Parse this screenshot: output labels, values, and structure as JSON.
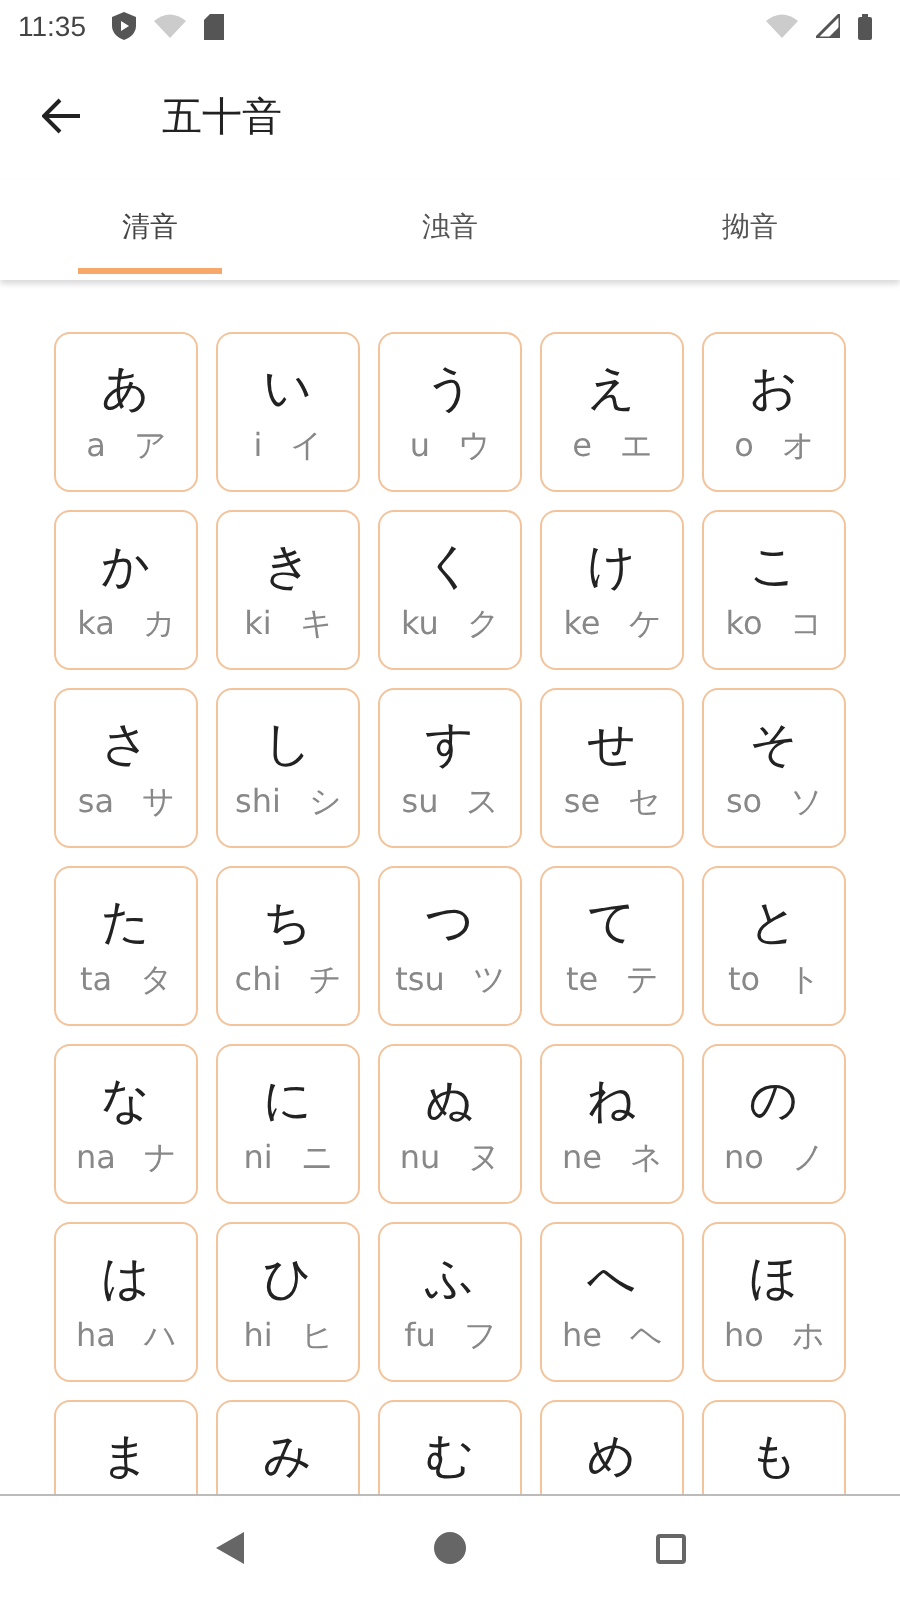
{
  "status_bar": {
    "time": "11:35"
  },
  "app_bar": {
    "title": "五十音"
  },
  "tabs": [
    {
      "label": "清音",
      "selected": true
    },
    {
      "label": "浊音",
      "selected": false
    },
    {
      "label": "拗音",
      "selected": false
    }
  ],
  "cards": [
    {
      "kana": "あ",
      "romaji": "a",
      "katakana": "ア"
    },
    {
      "kana": "い",
      "romaji": "i",
      "katakana": "イ"
    },
    {
      "kana": "う",
      "romaji": "u",
      "katakana": "ウ"
    },
    {
      "kana": "え",
      "romaji": "e",
      "katakana": "エ"
    },
    {
      "kana": "お",
      "romaji": "o",
      "katakana": "オ"
    },
    {
      "kana": "か",
      "romaji": "ka",
      "katakana": "カ"
    },
    {
      "kana": "き",
      "romaji": "ki",
      "katakana": "キ"
    },
    {
      "kana": "く",
      "romaji": "ku",
      "katakana": "ク"
    },
    {
      "kana": "け",
      "romaji": "ke",
      "katakana": "ケ"
    },
    {
      "kana": "こ",
      "romaji": "ko",
      "katakana": "コ"
    },
    {
      "kana": "さ",
      "romaji": "sa",
      "katakana": "サ"
    },
    {
      "kana": "し",
      "romaji": "shi",
      "katakana": "シ"
    },
    {
      "kana": "す",
      "romaji": "su",
      "katakana": "ス"
    },
    {
      "kana": "せ",
      "romaji": "se",
      "katakana": "セ"
    },
    {
      "kana": "そ",
      "romaji": "so",
      "katakana": "ソ"
    },
    {
      "kana": "た",
      "romaji": "ta",
      "katakana": "タ"
    },
    {
      "kana": "ち",
      "romaji": "chi",
      "katakana": "チ"
    },
    {
      "kana": "つ",
      "romaji": "tsu",
      "katakana": "ツ"
    },
    {
      "kana": "て",
      "romaji": "te",
      "katakana": "テ"
    },
    {
      "kana": "と",
      "romaji": "to",
      "katakana": "ト"
    },
    {
      "kana": "な",
      "romaji": "na",
      "katakana": "ナ"
    },
    {
      "kana": "に",
      "romaji": "ni",
      "katakana": "ニ"
    },
    {
      "kana": "ぬ",
      "romaji": "nu",
      "katakana": "ヌ"
    },
    {
      "kana": "ね",
      "romaji": "ne",
      "katakana": "ネ"
    },
    {
      "kana": "の",
      "romaji": "no",
      "katakana": "ノ"
    },
    {
      "kana": "は",
      "romaji": "ha",
      "katakana": "ハ"
    },
    {
      "kana": "ひ",
      "romaji": "hi",
      "katakana": "ヒ"
    },
    {
      "kana": "ふ",
      "romaji": "fu",
      "katakana": "フ"
    },
    {
      "kana": "へ",
      "romaji": "he",
      "katakana": "ヘ"
    },
    {
      "kana": "ほ",
      "romaji": "ho",
      "katakana": "ホ"
    },
    {
      "kana": "ま"
    },
    {
      "kana": "み"
    },
    {
      "kana": "む"
    },
    {
      "kana": "め"
    },
    {
      "kana": "も"
    }
  ]
}
